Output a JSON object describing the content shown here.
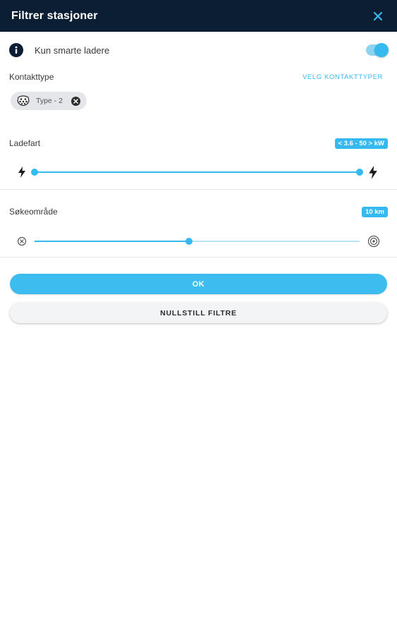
{
  "header": {
    "title": "Filtrer stasjoner",
    "close_icon": "close-icon"
  },
  "smart_chargers": {
    "label": "Kun smarte ladere",
    "icon": "info-icon",
    "toggle_on": true
  },
  "connector": {
    "label": "Kontakttype",
    "select_link": "VELG KONTAKTTYPER",
    "chips": [
      {
        "label": "Type - 2",
        "icon": "type2-plug-icon",
        "remove_icon": "remove-chip-icon"
      }
    ]
  },
  "charging_speed": {
    "label": "Ladefart",
    "badge": "< 3.6 - 50 > kW",
    "min_icon": "lightning-icon",
    "max_icon": "lightning-icon",
    "range_fraction": [
      0.0,
      1.0
    ]
  },
  "search_area": {
    "label": "Søkeområde",
    "badge": "10 km",
    "min_icon": "radius-small-icon",
    "max_icon": "radius-large-icon",
    "value_fraction": 0.475
  },
  "actions": {
    "ok_label": "OK",
    "reset_label": "NULLSTILL FILTRE"
  },
  "colors": {
    "accent": "#36b9ee",
    "header_bg": "#0c1e33",
    "chip_bg": "#e4e6e9"
  }
}
